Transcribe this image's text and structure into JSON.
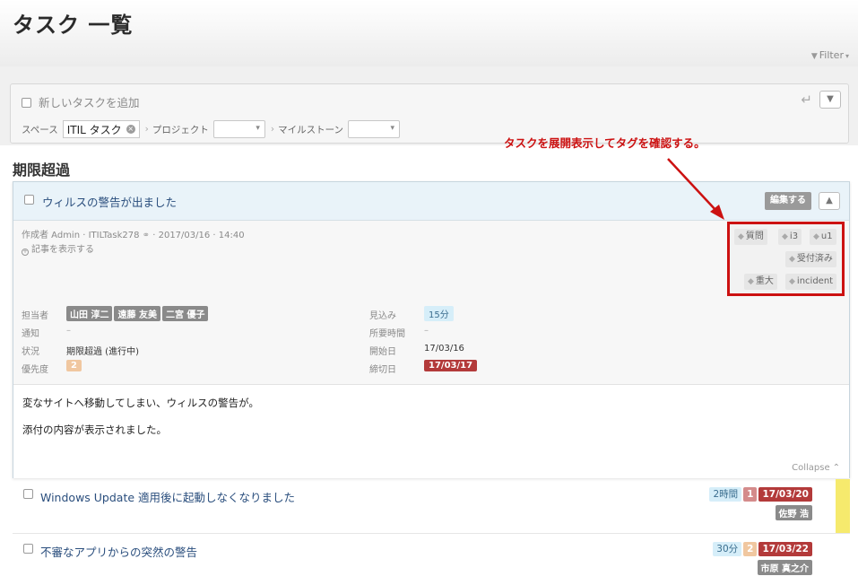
{
  "page": {
    "title": "タスク 一覧",
    "filter_label": "Filter"
  },
  "add_task": {
    "placeholder": "新しいタスクを追加",
    "space_label": "スペース",
    "space_value": "ITIL タスク",
    "project_label": "プロジェクト",
    "milestone_label": "マイルストーン"
  },
  "section": {
    "heading": "期限超過"
  },
  "annotation": {
    "text": "タスクを展開表示してタグを確認する。"
  },
  "expanded_task": {
    "title": "ウィルスの警告が出ました",
    "edit_label": "編集する",
    "meta": "作成者 Admin · ITILTask278",
    "meta_date": "· 2017/03/16 · 14:40",
    "show_article": "記事を表示する",
    "tags": [
      "質問",
      "i3",
      "u1",
      "受付済み",
      "重大",
      "incident"
    ],
    "labels": {
      "assignee": "担当者",
      "notify": "通知",
      "status": "状況",
      "priority": "優先度",
      "estimate": "見込み",
      "elapsed": "所要時間",
      "start": "開始日",
      "due": "締切日"
    },
    "assignees": [
      "山田 淳二",
      "遠藤 友美",
      "二宮 優子"
    ],
    "notify_value": "–",
    "status_value": "期限超過 (進行中)",
    "priority_value": "2",
    "estimate_value": "15分",
    "elapsed_value": "–",
    "start_value": "17/03/16",
    "due_value": "17/03/17",
    "description": [
      "変なサイトへ移動してしまい、ウィルスの警告が。",
      "添付の内容が表示されました。"
    ],
    "collapse_label": "Collapse"
  },
  "tasks": [
    {
      "title": "Windows Update 適用後に起動しなくなりました",
      "estimate": "2時間",
      "priority": "1",
      "due": "17/03/20",
      "owner": "佐野 浩"
    },
    {
      "title": "不審なアプリからの突然の警告",
      "estimate": "30分",
      "priority": "2",
      "due": "17/03/22",
      "owner": "市原 真之介"
    }
  ],
  "colors": {
    "annotation": "#cc1111",
    "due_badge": "#b33a3a",
    "link": "#2a4e7d"
  }
}
